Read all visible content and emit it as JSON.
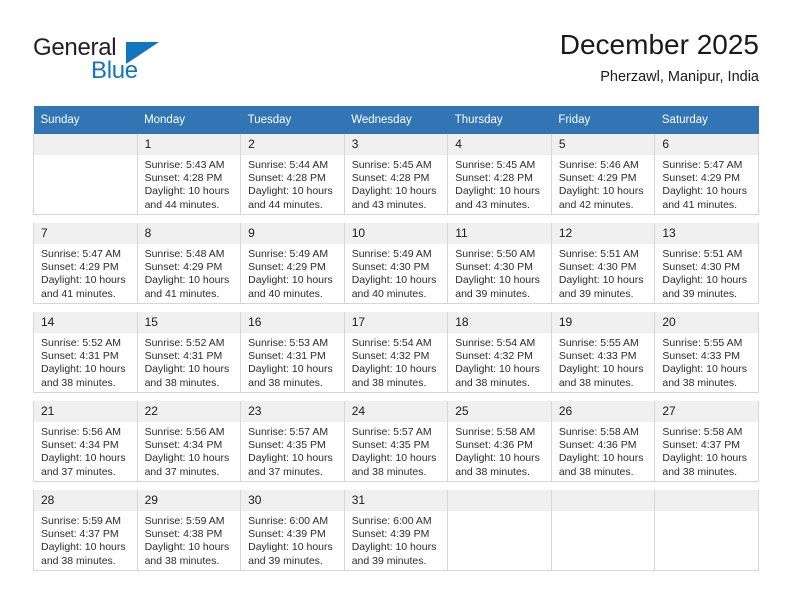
{
  "brand": {
    "name_top": "General",
    "name_bottom": "Blue",
    "accent_color": "#1175c0"
  },
  "header": {
    "title": "December 2025",
    "subtitle": "Pherzawl, Manipur, India"
  },
  "calendar": {
    "header_bg": "#3175b4",
    "daynum_bg": "#f0f0f0",
    "weekdays": [
      "Sunday",
      "Monday",
      "Tuesday",
      "Wednesday",
      "Thursday",
      "Friday",
      "Saturday"
    ],
    "weeks": [
      [
        {
          "day": "",
          "lines": []
        },
        {
          "day": "1",
          "lines": [
            "Sunrise: 5:43 AM",
            "Sunset: 4:28 PM",
            "Daylight: 10 hours",
            "and 44 minutes."
          ]
        },
        {
          "day": "2",
          "lines": [
            "Sunrise: 5:44 AM",
            "Sunset: 4:28 PM",
            "Daylight: 10 hours",
            "and 44 minutes."
          ]
        },
        {
          "day": "3",
          "lines": [
            "Sunrise: 5:45 AM",
            "Sunset: 4:28 PM",
            "Daylight: 10 hours",
            "and 43 minutes."
          ]
        },
        {
          "day": "4",
          "lines": [
            "Sunrise: 5:45 AM",
            "Sunset: 4:28 PM",
            "Daylight: 10 hours",
            "and 43 minutes."
          ]
        },
        {
          "day": "5",
          "lines": [
            "Sunrise: 5:46 AM",
            "Sunset: 4:29 PM",
            "Daylight: 10 hours",
            "and 42 minutes."
          ]
        },
        {
          "day": "6",
          "lines": [
            "Sunrise: 5:47 AM",
            "Sunset: 4:29 PM",
            "Daylight: 10 hours",
            "and 41 minutes."
          ]
        }
      ],
      [
        {
          "day": "7",
          "lines": [
            "Sunrise: 5:47 AM",
            "Sunset: 4:29 PM",
            "Daylight: 10 hours",
            "and 41 minutes."
          ]
        },
        {
          "day": "8",
          "lines": [
            "Sunrise: 5:48 AM",
            "Sunset: 4:29 PM",
            "Daylight: 10 hours",
            "and 41 minutes."
          ]
        },
        {
          "day": "9",
          "lines": [
            "Sunrise: 5:49 AM",
            "Sunset: 4:29 PM",
            "Daylight: 10 hours",
            "and 40 minutes."
          ]
        },
        {
          "day": "10",
          "lines": [
            "Sunrise: 5:49 AM",
            "Sunset: 4:30 PM",
            "Daylight: 10 hours",
            "and 40 minutes."
          ]
        },
        {
          "day": "11",
          "lines": [
            "Sunrise: 5:50 AM",
            "Sunset: 4:30 PM",
            "Daylight: 10 hours",
            "and 39 minutes."
          ]
        },
        {
          "day": "12",
          "lines": [
            "Sunrise: 5:51 AM",
            "Sunset: 4:30 PM",
            "Daylight: 10 hours",
            "and 39 minutes."
          ]
        },
        {
          "day": "13",
          "lines": [
            "Sunrise: 5:51 AM",
            "Sunset: 4:30 PM",
            "Daylight: 10 hours",
            "and 39 minutes."
          ]
        }
      ],
      [
        {
          "day": "14",
          "lines": [
            "Sunrise: 5:52 AM",
            "Sunset: 4:31 PM",
            "Daylight: 10 hours",
            "and 38 minutes."
          ]
        },
        {
          "day": "15",
          "lines": [
            "Sunrise: 5:52 AM",
            "Sunset: 4:31 PM",
            "Daylight: 10 hours",
            "and 38 minutes."
          ]
        },
        {
          "day": "16",
          "lines": [
            "Sunrise: 5:53 AM",
            "Sunset: 4:31 PM",
            "Daylight: 10 hours",
            "and 38 minutes."
          ]
        },
        {
          "day": "17",
          "lines": [
            "Sunrise: 5:54 AM",
            "Sunset: 4:32 PM",
            "Daylight: 10 hours",
            "and 38 minutes."
          ]
        },
        {
          "day": "18",
          "lines": [
            "Sunrise: 5:54 AM",
            "Sunset: 4:32 PM",
            "Daylight: 10 hours",
            "and 38 minutes."
          ]
        },
        {
          "day": "19",
          "lines": [
            "Sunrise: 5:55 AM",
            "Sunset: 4:33 PM",
            "Daylight: 10 hours",
            "and 38 minutes."
          ]
        },
        {
          "day": "20",
          "lines": [
            "Sunrise: 5:55 AM",
            "Sunset: 4:33 PM",
            "Daylight: 10 hours",
            "and 38 minutes."
          ]
        }
      ],
      [
        {
          "day": "21",
          "lines": [
            "Sunrise: 5:56 AM",
            "Sunset: 4:34 PM",
            "Daylight: 10 hours",
            "and 37 minutes."
          ]
        },
        {
          "day": "22",
          "lines": [
            "Sunrise: 5:56 AM",
            "Sunset: 4:34 PM",
            "Daylight: 10 hours",
            "and 37 minutes."
          ]
        },
        {
          "day": "23",
          "lines": [
            "Sunrise: 5:57 AM",
            "Sunset: 4:35 PM",
            "Daylight: 10 hours",
            "and 37 minutes."
          ]
        },
        {
          "day": "24",
          "lines": [
            "Sunrise: 5:57 AM",
            "Sunset: 4:35 PM",
            "Daylight: 10 hours",
            "and 38 minutes."
          ]
        },
        {
          "day": "25",
          "lines": [
            "Sunrise: 5:58 AM",
            "Sunset: 4:36 PM",
            "Daylight: 10 hours",
            "and 38 minutes."
          ]
        },
        {
          "day": "26",
          "lines": [
            "Sunrise: 5:58 AM",
            "Sunset: 4:36 PM",
            "Daylight: 10 hours",
            "and 38 minutes."
          ]
        },
        {
          "day": "27",
          "lines": [
            "Sunrise: 5:58 AM",
            "Sunset: 4:37 PM",
            "Daylight: 10 hours",
            "and 38 minutes."
          ]
        }
      ],
      [
        {
          "day": "28",
          "lines": [
            "Sunrise: 5:59 AM",
            "Sunset: 4:37 PM",
            "Daylight: 10 hours",
            "and 38 minutes."
          ]
        },
        {
          "day": "29",
          "lines": [
            "Sunrise: 5:59 AM",
            "Sunset: 4:38 PM",
            "Daylight: 10 hours",
            "and 38 minutes."
          ]
        },
        {
          "day": "30",
          "lines": [
            "Sunrise: 6:00 AM",
            "Sunset: 4:39 PM",
            "Daylight: 10 hours",
            "and 39 minutes."
          ]
        },
        {
          "day": "31",
          "lines": [
            "Sunrise: 6:00 AM",
            "Sunset: 4:39 PM",
            "Daylight: 10 hours",
            "and 39 minutes."
          ]
        },
        {
          "day": "",
          "lines": []
        },
        {
          "day": "",
          "lines": []
        },
        {
          "day": "",
          "lines": []
        }
      ]
    ]
  }
}
